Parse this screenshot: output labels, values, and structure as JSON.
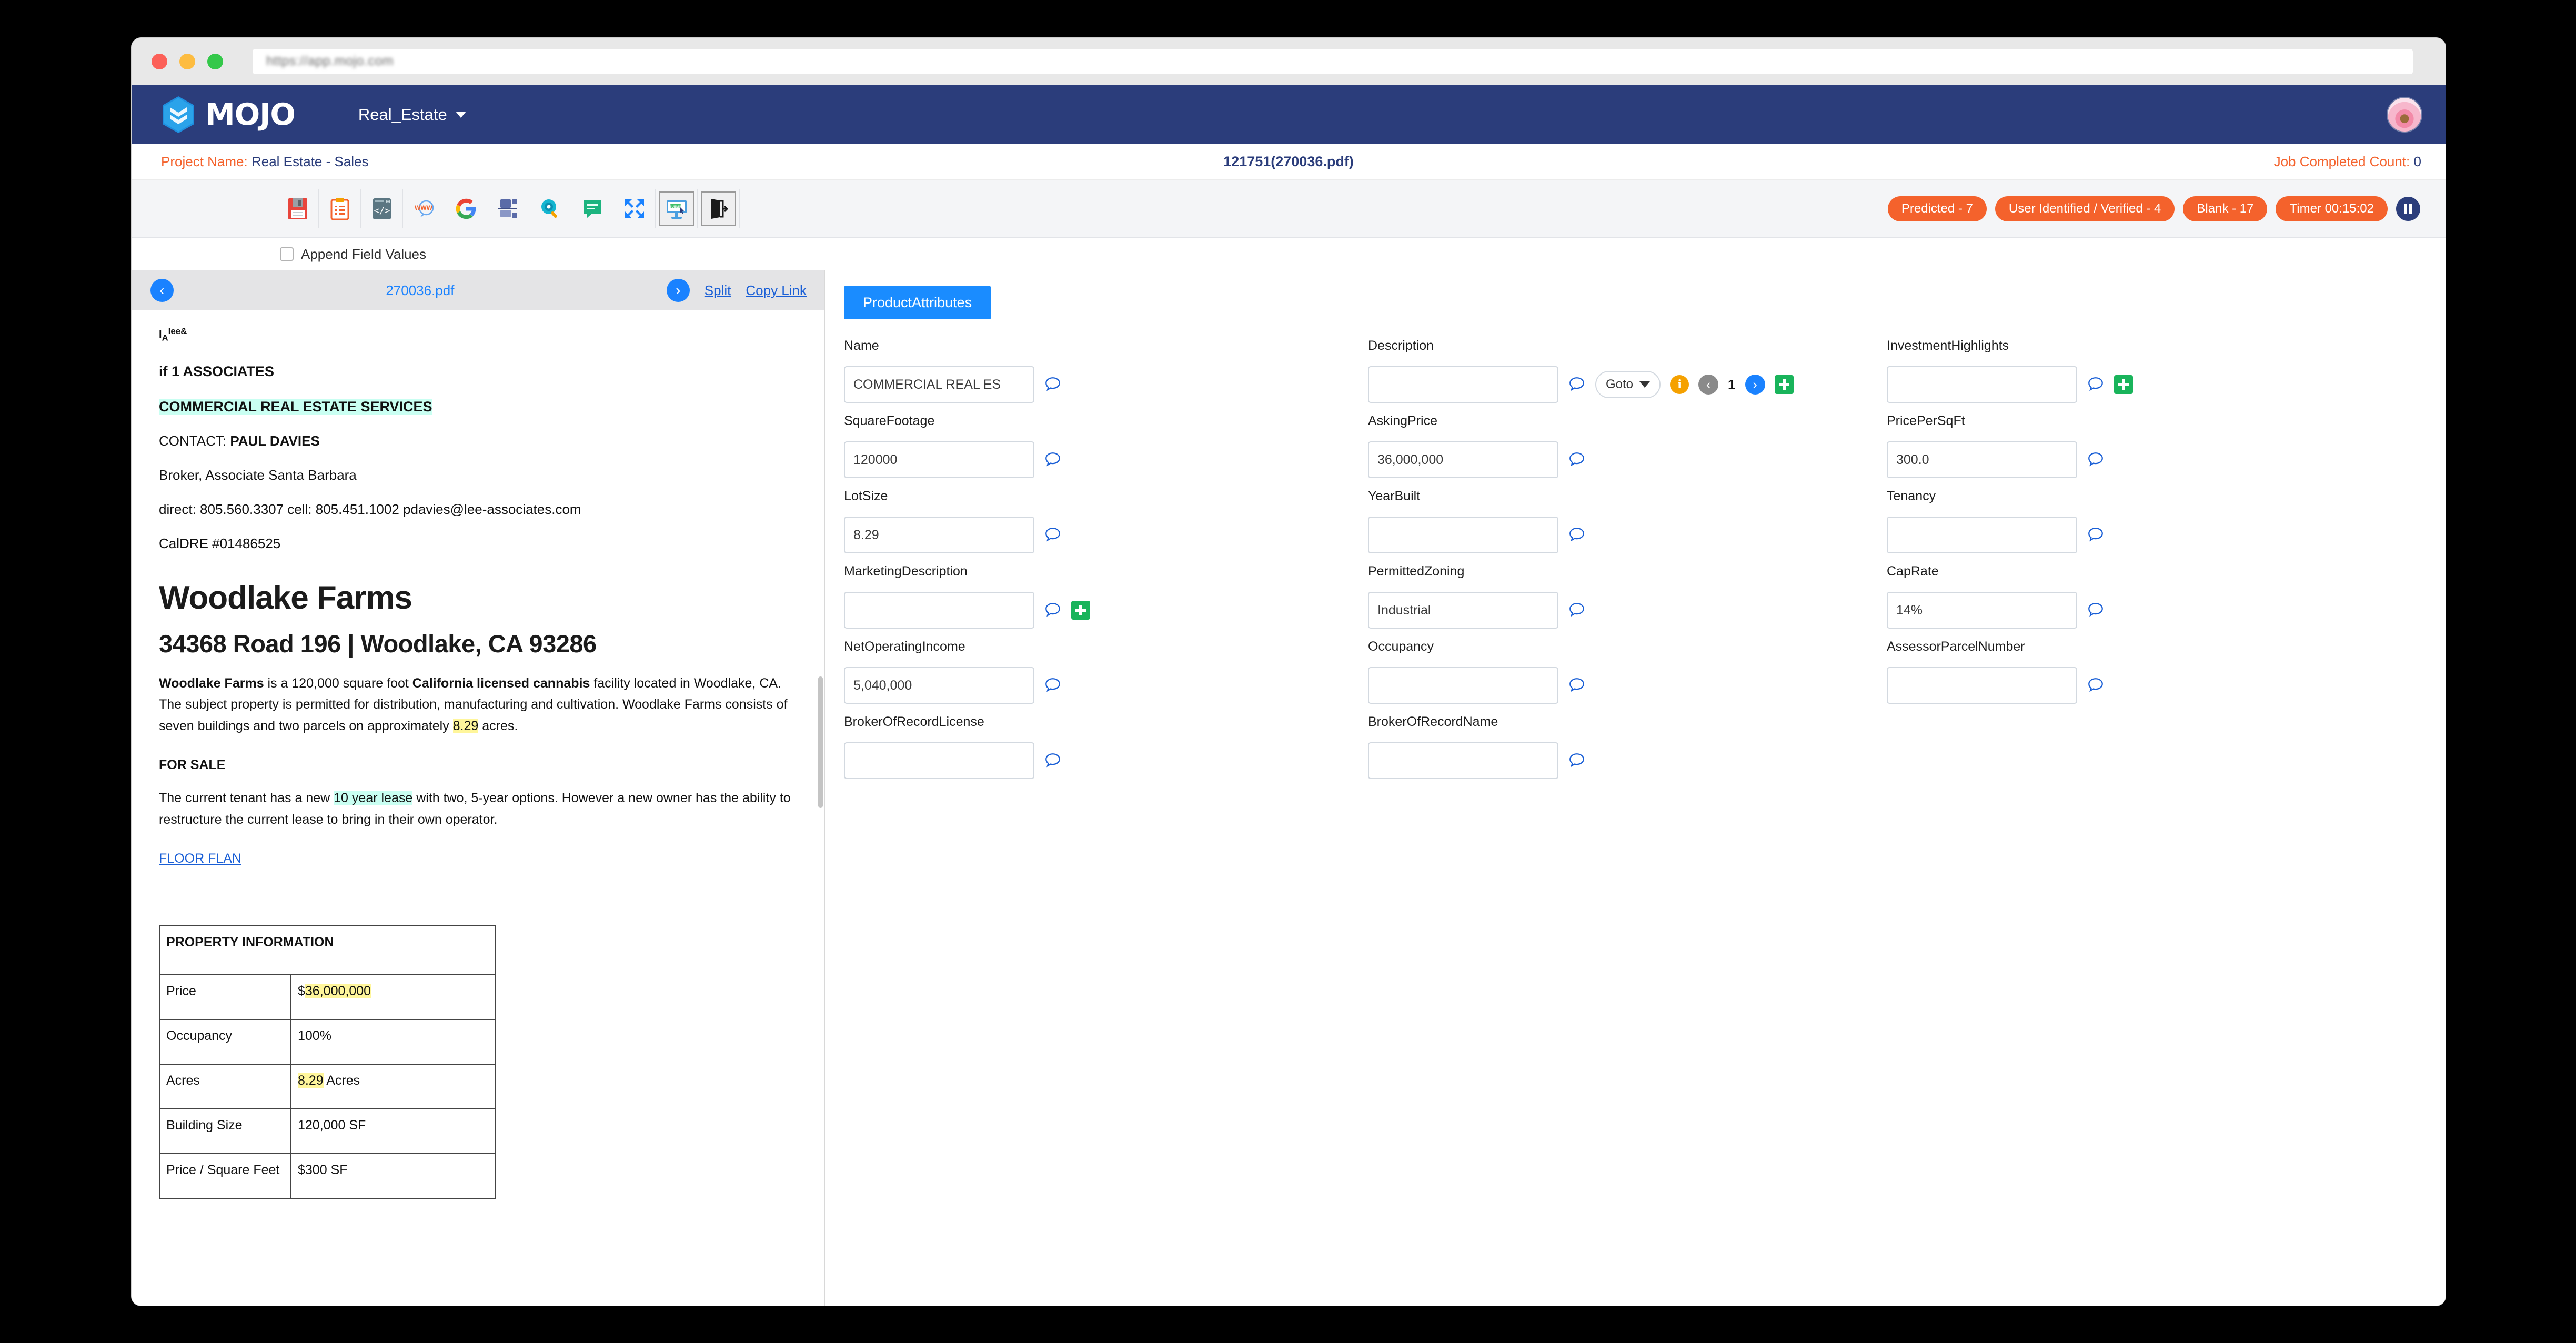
{
  "browser": {
    "url": "https://app.mojo.com",
    "traffic_lights": [
      "close",
      "minimize",
      "maximize"
    ]
  },
  "navbar": {
    "brand": "MOJO",
    "project_dropdown": "Real_Estate",
    "avatar_alt": "user-avatar"
  },
  "projectbar": {
    "project_label": "Project Name:",
    "project_value": "Real Estate - Sales",
    "file_title": "121751(270036.pdf)",
    "job_label": "Job Completed Count:",
    "job_count": "0"
  },
  "toolbar": {
    "icons": [
      "save-icon",
      "clipboard-icon",
      "code-icon",
      "www-icon",
      "google-icon",
      "layout-icon",
      "zoom-search-icon",
      "comment-icon",
      "expand-icon",
      "submit-screen-icon",
      "exit-icon"
    ],
    "badges": [
      "Predicted - 7",
      "User Identified / Verified - 4",
      "Blank - 17",
      "Timer 00:15:02"
    ],
    "pause_label": "pause"
  },
  "append_row": {
    "checkbox_label": "Append Field Values",
    "checked": false
  },
  "pdf_pane": {
    "prev_label": "‹",
    "next_label": "›",
    "file_name": "270036.pdf",
    "split_label": "Split",
    "copy_link_label": "Copy Link",
    "document": {
      "logo_prefix": "l",
      "logo_sub": "A",
      "logo_sup": "lee&",
      "associates": "if 1 ASSOCIATES",
      "services": "COMMERCIAL REAL ESTATE SERVICES",
      "contact_label": "CONTACT:",
      "contact_name": "PAUL DAVIES",
      "role": "Broker, Associate Santa Barbara",
      "phones": "direct: 805.560.3307 cell: 805.451.1002 pdavies@lee-associates.com",
      "license": "CalDRE #01486525",
      "title": "Woodlake Farms",
      "address": "34368 Road 196 | Woodlake, CA 93286",
      "body_p1_a": "Woodlake Farms",
      "body_p1_b": " is a 120,000 square foot ",
      "body_p1_c": "California licensed cannabis",
      "body_p1_d": " facility located in Woodlake, CA. The subject property is permitted for distribution, manufacturing and cultivation. Woodlake Farms consists of seven buildings and two parcels on approximately ",
      "body_p1_hl": "8.29",
      "body_p1_e": " acres.",
      "for_sale": "FOR SALE",
      "body_p2_a": "The current tenant has a new ",
      "body_p2_hl": "10 year lease",
      "body_p2_b": " with two, 5-year options. However a new owner has the ability to restructure the current lease to bring in their own operator.",
      "floor_plan_link": "FLOOR FLAN",
      "table_title": "PROPERTY INFORMATION",
      "table_rows": [
        {
          "key": "Price",
          "value_hl": "36,000,000",
          "value_prefix": "$",
          "value_suffix": ""
        },
        {
          "key": "Occupancy",
          "value_hl": "",
          "value_prefix": "100%",
          "value_suffix": ""
        },
        {
          "key": "Acres",
          "value_hl": "8.29",
          "value_prefix": "",
          "value_suffix": " Acres"
        },
        {
          "key": "Building Size",
          "value_hl": "",
          "value_prefix": "120,000 SF",
          "value_suffix": ""
        },
        {
          "key": "Price / Square Feet",
          "value_hl": "",
          "value_prefix": "$300 SF",
          "value_suffix": ""
        }
      ]
    }
  },
  "fields_pane": {
    "tab": "ProductAttributes",
    "goto_label": "Goto",
    "page_number": "1",
    "fields": [
      {
        "label": "Name",
        "value": "COMMERCIAL REAL ES",
        "has_plus": false,
        "has_goto": false
      },
      {
        "label": "Description",
        "value": "",
        "has_plus": true,
        "has_goto": true
      },
      {
        "label": "InvestmentHighlights",
        "value": "",
        "has_plus": true,
        "has_goto": false
      },
      {
        "label": "SquareFootage",
        "value": "120000",
        "has_plus": false,
        "has_goto": false
      },
      {
        "label": "AskingPrice",
        "value": "36,000,000",
        "has_plus": false,
        "has_goto": false
      },
      {
        "label": "PricePerSqFt",
        "value": "300.0",
        "has_plus": false,
        "has_goto": false
      },
      {
        "label": "LotSize",
        "value": "8.29",
        "has_plus": false,
        "has_goto": false
      },
      {
        "label": "YearBuilt",
        "value": "",
        "has_plus": false,
        "has_goto": false
      },
      {
        "label": "Tenancy",
        "value": "",
        "has_plus": false,
        "has_goto": false
      },
      {
        "label": "MarketingDescription",
        "value": "",
        "has_plus": true,
        "has_goto": false
      },
      {
        "label": "PermittedZoning",
        "value": "Industrial",
        "has_plus": false,
        "has_goto": false
      },
      {
        "label": "CapRate",
        "value": "14%",
        "has_plus": false,
        "has_goto": false
      },
      {
        "label": "NetOperatingIncome",
        "value": "5,040,000",
        "has_plus": false,
        "has_goto": false
      },
      {
        "label": "Occupancy",
        "value": "",
        "has_plus": false,
        "has_goto": false
      },
      {
        "label": "AssessorParcelNumber",
        "value": "",
        "has_plus": false,
        "has_goto": false
      },
      {
        "label": "BrokerOfRecordLicense",
        "value": "",
        "has_plus": false,
        "has_goto": false
      },
      {
        "label": "BrokerOfRecordName",
        "value": "",
        "has_plus": false,
        "has_goto": false
      }
    ]
  },
  "colors": {
    "navy": "#2b3d7b",
    "orange": "#f4622c",
    "blue": "#1a82ff",
    "tab_blue": "#1a8cff",
    "green": "#19b45b",
    "highlight_yellow": "#fff69b",
    "highlight_cyan": "#c9fff2"
  }
}
